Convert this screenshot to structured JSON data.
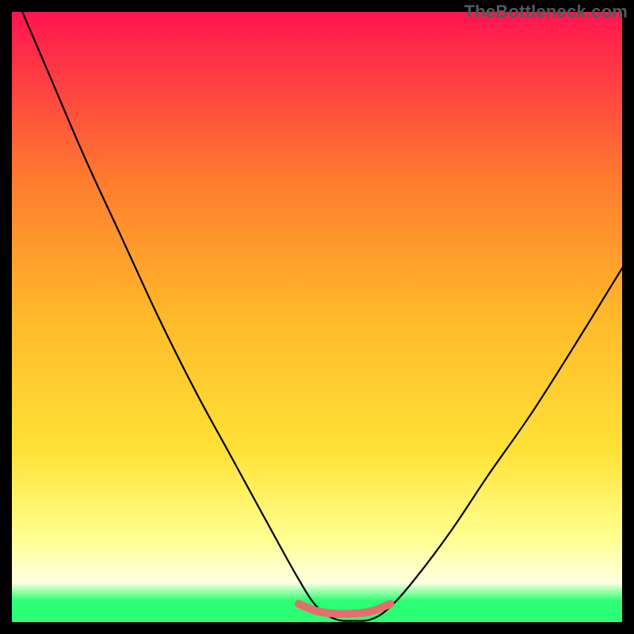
{
  "watermark": "TheBottleneck.com",
  "colors": {
    "frame": "#000000",
    "grad_top": "#ff1450",
    "grad_mid_upper": "#ff7d2e",
    "grad_mid": "#ffb92a",
    "grad_mid_lower": "#ffe236",
    "grad_light": "#ffff8f",
    "grad_pale": "#ffffe0",
    "grad_green": "#2cff73",
    "curve": "#000000",
    "bottom_accent": "#e46e6d"
  },
  "chart_data": {
    "type": "line",
    "title": "",
    "xlabel": "",
    "ylabel": "",
    "xlim": [
      0,
      100
    ],
    "ylim": [
      0,
      100
    ],
    "grid": false,
    "series": [
      {
        "name": "bottleneck-curve",
        "x": [
          0,
          6,
          12,
          18,
          24,
          30,
          36,
          42,
          47,
          50,
          53,
          56,
          59,
          62,
          66,
          72,
          78,
          85,
          92,
          100
        ],
        "y": [
          104,
          90,
          76,
          63,
          50,
          38,
          27,
          16,
          7,
          2.5,
          0.5,
          0.2,
          0.5,
          2.5,
          7,
          15,
          24,
          34,
          45,
          58
        ]
      },
      {
        "name": "bottom-accent-segment",
        "x": [
          47,
          50,
          53,
          56,
          59,
          62
        ],
        "y": [
          3.0,
          1.8,
          1.4,
          1.4,
          1.8,
          3.0
        ]
      }
    ],
    "note": "Values are read off by estimation from an unlabeled axes chart; x is horizontal percent across plot, y is vertical percent from bottom."
  }
}
